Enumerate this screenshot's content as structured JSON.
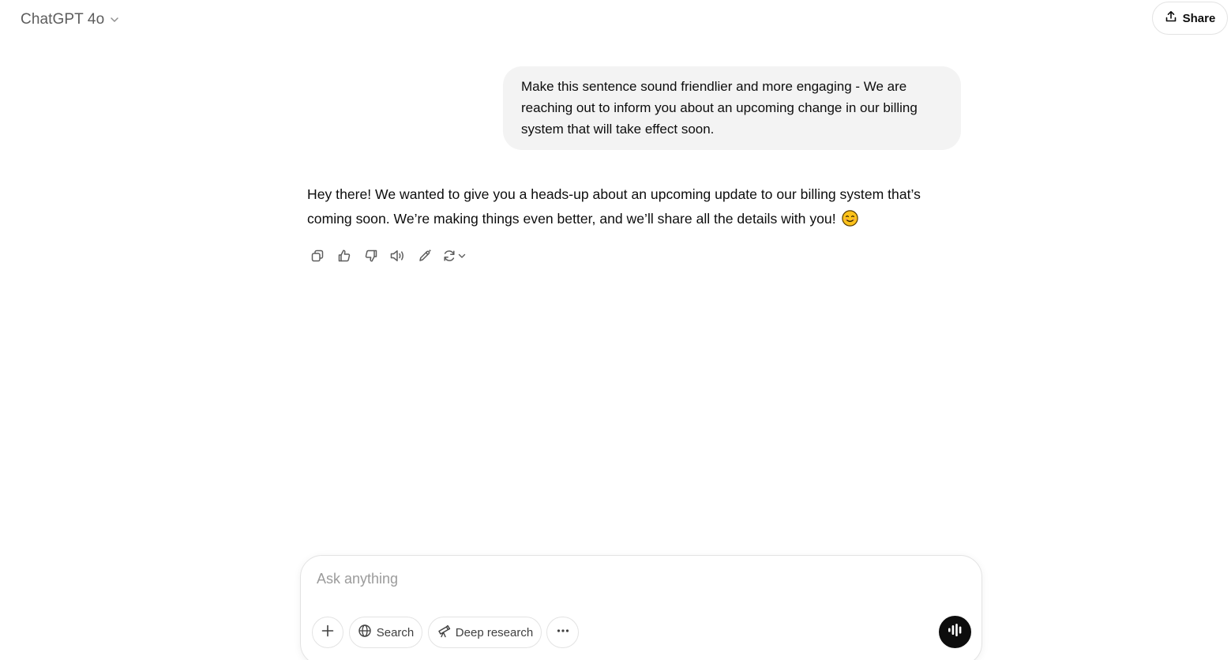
{
  "header": {
    "model_name": "ChatGPT 4o",
    "share_label": "Share"
  },
  "conversation": {
    "user_message": "Make this sentence sound friendlier and more engaging - We are reaching out to inform you about an upcoming change in our billing system that will take effect soon.",
    "assistant_message": "Hey there! We wanted to give you a heads-up about an upcoming update to our billing system that’s coming soon. We’re making things even better, and we’ll share all the details with you!",
    "assistant_emoji": "smiling-face-emoji",
    "action_icons": [
      "copy-icon",
      "thumbs-up-icon",
      "thumbs-down-icon",
      "read-aloud-icon",
      "edit-icon",
      "regenerate-icon",
      "chevron-down-icon"
    ]
  },
  "composer": {
    "placeholder": "Ask anything",
    "value": "",
    "tools": {
      "search_label": "Search",
      "deep_research_label": "Deep research"
    }
  },
  "colors": {
    "user_bubble_bg": "#f3f3f3",
    "voice_button_bg": "#0d0d0d",
    "border": "#e3e3e3",
    "muted_text": "#5d5d5d"
  }
}
